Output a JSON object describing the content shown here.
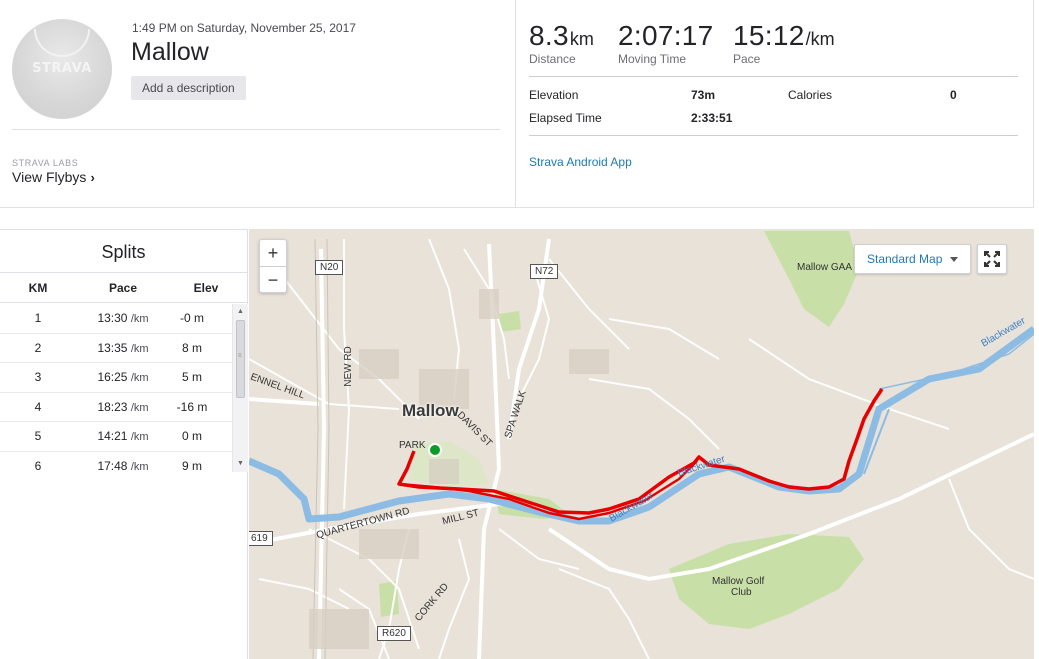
{
  "activity": {
    "datetime": "1:49 PM on Saturday, November 25, 2017",
    "title": "Mallow",
    "add_description_label": "Add a description",
    "avatar_logo": "STRAVA"
  },
  "labs": {
    "caption": "STRAVA LABS",
    "flybys_label": "View Flybys",
    "chevron": "›"
  },
  "stats": {
    "distance": {
      "value": "8.3",
      "unit": "km",
      "label": "Distance"
    },
    "moving_time": {
      "value": "2:07:17",
      "label": "Moving Time"
    },
    "pace": {
      "value": "15:12",
      "unit": "/km",
      "label": "Pace"
    },
    "elevation": {
      "label": "Elevation",
      "value": "73m"
    },
    "calories": {
      "label": "Calories",
      "value": "0"
    },
    "elapsed": {
      "label": "Elapsed Time",
      "value": "2:33:51"
    },
    "device_link": "Strava Android App"
  },
  "splits": {
    "title": "Splits",
    "headers": {
      "km": "KM",
      "pace": "Pace",
      "elev": "Elev"
    },
    "pace_unit": "/km",
    "rows": [
      {
        "km": "1",
        "pace": "13:30",
        "elev": "-0 m"
      },
      {
        "km": "2",
        "pace": "13:35",
        "elev": "8 m"
      },
      {
        "km": "3",
        "pace": "16:25",
        "elev": "5 m"
      },
      {
        "km": "4",
        "pace": "18:23",
        "elev": "-16 m"
      },
      {
        "km": "5",
        "pace": "14:21",
        "elev": "0 m"
      },
      {
        "km": "6",
        "pace": "17:48",
        "elev": "9 m"
      }
    ]
  },
  "map": {
    "zoom_in": "+",
    "zoom_out": "−",
    "map_type": "Standard Map",
    "town": "Mallow",
    "labels": {
      "n20": "N20",
      "n72": "N72",
      "r619": "619",
      "r620": "R620",
      "mallow_gaa": "Mallow GAA",
      "blackwater_ne": "Blackwater",
      "blackwater_mid": "Blackwater",
      "blackwater_w": "Blackwater",
      "fennel_hill": "ENNEL HILL",
      "new_rd": "NEW RD",
      "davis_st": "DAVIS ST",
      "spa_walk": "SPA WALK",
      "park": "PARK",
      "quartertown": "QUARTERTOWN RD",
      "mill_st": "MILL ST",
      "cork_rd": "CORK RD",
      "golf_club_1": "Mallow Golf",
      "golf_club_2": "Club"
    },
    "colors": {
      "route": "#e60000",
      "river": "#6fa8dc",
      "start": "#0b9b28",
      "land": "#e8e2d8",
      "park": "#c9dfa8"
    }
  }
}
